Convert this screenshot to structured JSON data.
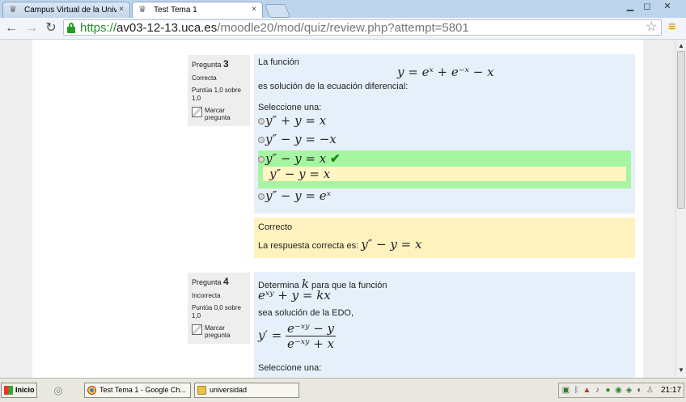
{
  "browser": {
    "tabs": [
      {
        "title": "Campus Virtual de la Universi",
        "active": false
      },
      {
        "title": "Test Tema 1",
        "active": true
      }
    ],
    "window_buttons": {
      "minimize": "▁",
      "maximize": "◻",
      "close": "✕"
    },
    "url": {
      "scheme": "https://",
      "host": "av03-12-13.uca.es",
      "path": "/moodle20/mod/quiz/review.php?attempt=5801"
    },
    "icons": {
      "back": "←",
      "forward": "→",
      "reload": "↻",
      "star": "☆",
      "menu": "≡",
      "tab_close": "×"
    }
  },
  "questions": [
    {
      "number_label": "Pregunta",
      "number": "3",
      "state": "Correcta",
      "grade": "Puntúa 1,0 sobre 1,0",
      "flag_label": "Marcar pregunta",
      "intro": "La función",
      "equation": "y = eˣ + e⁻ˣ − x",
      "statement": "es solución de la ecuación diferencial:",
      "prompt": "Seleccione una:",
      "options": [
        {
          "text": "y″ + y = x",
          "selected": false
        },
        {
          "text": "y″ − y = −x",
          "selected": false
        },
        {
          "text": "y″ − y = x",
          "selected": true,
          "correct": true
        },
        {
          "text": "y″ − y = eˣ",
          "selected": false
        }
      ],
      "selected_feedback": "y″ − y = x",
      "check_mark": "✔",
      "outcome_title": "Correcto",
      "outcome_text": "La respuesta correcta es:",
      "outcome_answer": "y″ − y = x"
    },
    {
      "number_label": "Pregunta",
      "number": "4",
      "state": "Incorrecta",
      "grade": "Puntúa 0,0 sobre 1,0",
      "flag_label": "Marcar pregunta",
      "intro_before": "Determina",
      "variable": "k",
      "intro_after": "para que la  función",
      "equation": "eˣʸ + y = kx",
      "statement": "sea solución de la EDO,",
      "ode_lhs": "y′ =",
      "ode_numerator": "e⁻ˣʸ − y",
      "ode_denominator": "e⁻ˣʸ + x",
      "prompt": "Seleccione una:"
    }
  ],
  "taskbar": {
    "start": "Inicio",
    "tasks": [
      {
        "label": "Test Tema 1 - Google Ch..."
      },
      {
        "label": "universidad"
      }
    ],
    "clock": "21:17"
  }
}
